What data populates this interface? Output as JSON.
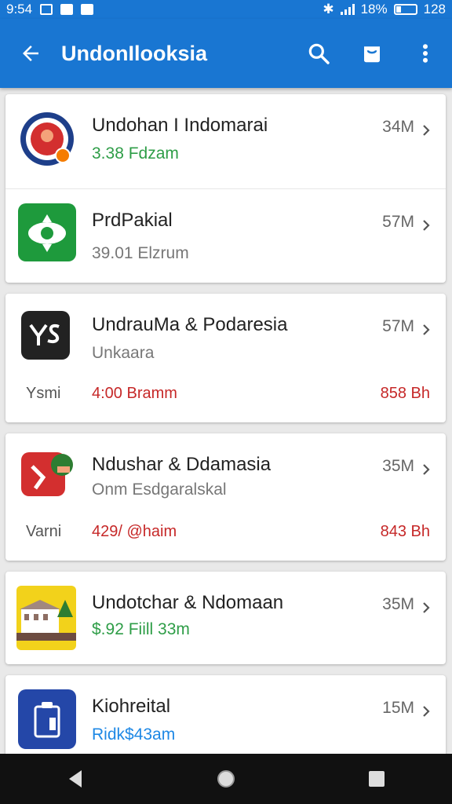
{
  "status_bar": {
    "time": "9:54",
    "battery_percent": "18%",
    "extra": "128"
  },
  "app_bar": {
    "title": "UndonIlooksia",
    "back_icon": "arrow-back-icon",
    "search_icon": "search-icon",
    "bag_icon": "shopping-bag-icon",
    "more_icon": "more-vert-icon"
  },
  "colors": {
    "primary": "#1976d2",
    "green": "#2e9d47",
    "red": "#c62828",
    "blue": "#1e88e5"
  },
  "cards": [
    {
      "rows": [
        {
          "name": "Undohan I Indomarai",
          "sub": "3.38 Fdzam",
          "size": "34M",
          "icon": "red-target-icon"
        },
        {
          "name": "PrdPakial",
          "sub": "39.01 Elzrum",
          "size": "57M",
          "icon": "green-emblem-icon"
        }
      ]
    },
    {
      "rows": [
        {
          "name": "UndrauMa & Podaresia",
          "sub": "Unkaara",
          "size": "57M",
          "icon": "black-ys-icon"
        }
      ],
      "footer": {
        "label": "Ysmi",
        "value": "4:00 Bramm",
        "amount": "858 Bh"
      }
    },
    {
      "rows": [
        {
          "name": "Ndushar & Ddamasia",
          "sub": "Onm Esdgaralskal",
          "size": "35M",
          "icon": "red-puzzle-icon"
        }
      ],
      "footer": {
        "label": "Varni",
        "value": "429/ @haim",
        "amount": "843 Bh"
      }
    },
    {
      "rows": [
        {
          "name": "Undotchar & Ndomaan",
          "sub": "$.92 Fiill 33m",
          "size": "35M",
          "icon": "yellow-building-icon"
        }
      ]
    },
    {
      "rows": [
        {
          "name": "Kiohreital",
          "sub": "Ridk$43am",
          "size": "15M",
          "icon": "blue-clipboard-icon"
        }
      ]
    }
  ],
  "nav_bar": {
    "back": "nav-back-icon",
    "home": "nav-home-icon",
    "recents": "nav-recents-icon"
  }
}
